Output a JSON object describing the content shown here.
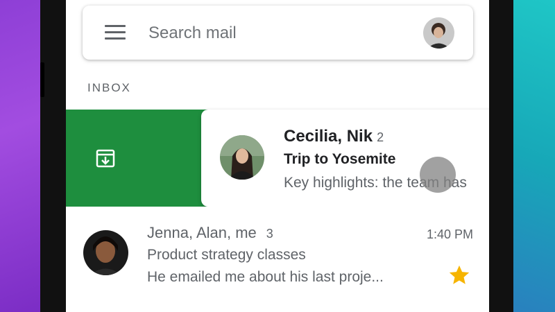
{
  "search": {
    "placeholder": "Search mail"
  },
  "section": {
    "label": "INBOX"
  },
  "colors": {
    "archive_green": "#1e8e3e",
    "star_yellow": "#f6b400"
  },
  "messages": [
    {
      "sender": "Cecilia, Nik",
      "count": "2",
      "subject": "Trip to Yosemite",
      "snippet": "Key highlights: the team has",
      "unread": true,
      "state": "swiped-archive"
    },
    {
      "sender": "Jenna, Alan, me",
      "count": "3",
      "subject": "Product strategy classes",
      "snippet": "He emailed me about his last proje...",
      "time": "1:40 PM",
      "starred": true,
      "unread": false
    }
  ],
  "icons": {
    "menu": "menu-icon",
    "archive": "archive-icon",
    "star": "star-icon"
  }
}
